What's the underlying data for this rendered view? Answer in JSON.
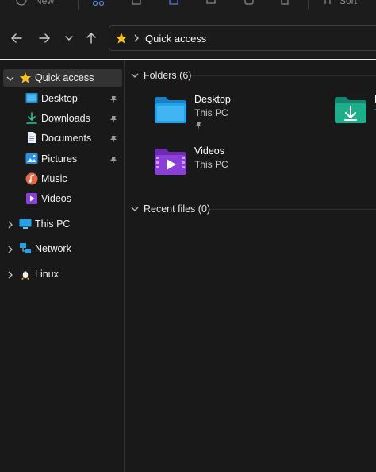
{
  "toolbar": {
    "new_label": "New",
    "sort_label": "Sort"
  },
  "address": {
    "path_label": "Quick access"
  },
  "sidebar": {
    "quick_access": "Quick access",
    "pinned": [
      {
        "label": "Desktop",
        "pinned": true
      },
      {
        "label": "Downloads",
        "pinned": true
      },
      {
        "label": "Documents",
        "pinned": true
      },
      {
        "label": "Pictures",
        "pinned": true
      },
      {
        "label": "Music",
        "pinned": false
      },
      {
        "label": "Videos",
        "pinned": false
      }
    ],
    "roots": [
      {
        "label": "This PC"
      },
      {
        "label": "Network"
      },
      {
        "label": "Linux"
      }
    ]
  },
  "main": {
    "folders_header": "Folders (6)",
    "recent_header": "Recent files (0)",
    "folders": [
      {
        "name": "Desktop",
        "location": "This PC"
      },
      {
        "name": "D",
        "location": "T"
      },
      {
        "name": "Videos",
        "location": "This PC"
      }
    ]
  },
  "colors": {
    "background": "#191919",
    "selected": "#333333",
    "star": "#f6c21a",
    "folder_blue": "#1d9be0",
    "folder_green": "#1fa58a",
    "folder_purple": "#8b3fd6"
  }
}
